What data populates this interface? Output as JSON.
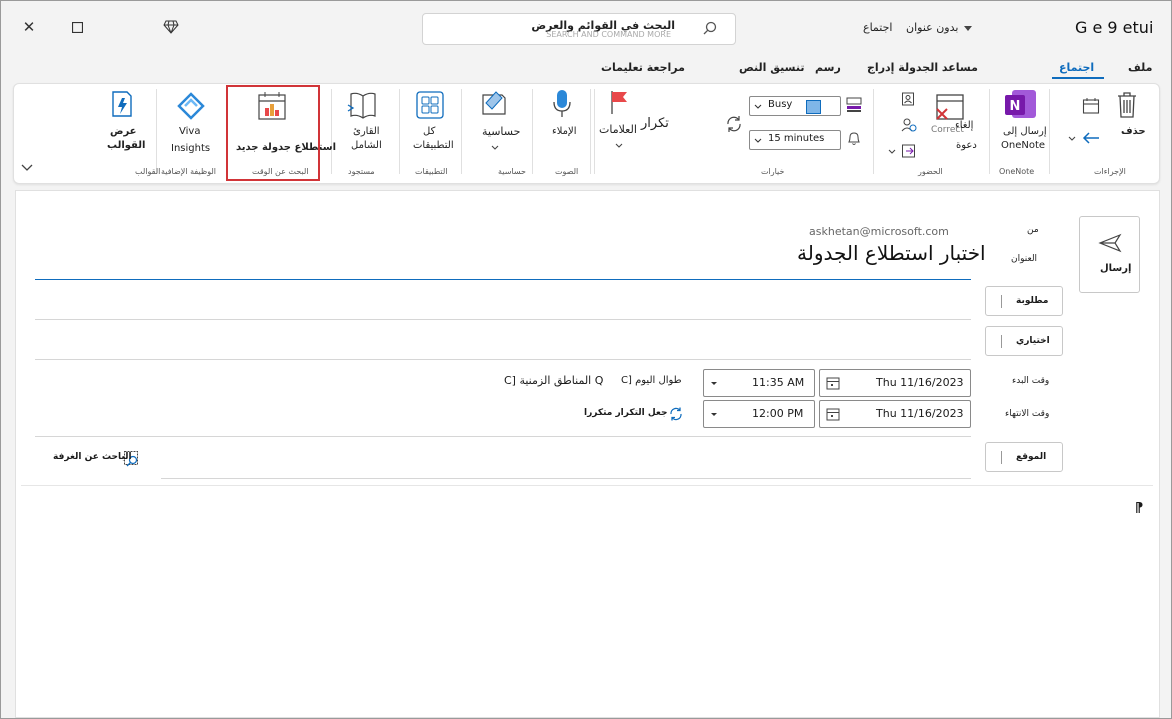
{
  "window": {
    "app_name": "G e 9 etui",
    "title_name": "بدون عنوان",
    "title_type": "اجتماع",
    "search_text": "البحث في القوائم والعرض",
    "search_placeholder": "SEARCH AND COMMAND MORE"
  },
  "tabs": [
    {
      "label": "ملف"
    },
    {
      "label": "اجتماع"
    },
    {
      "label": "مساعد الجدولة إدراج"
    },
    {
      "label": "رسم"
    },
    {
      "label": "تنسيق النص"
    },
    {
      "label": "مراجعة تعليمات"
    }
  ],
  "ribbon": {
    "delete_label": "حذف",
    "onenote_label1": "إرسال إلى",
    "onenote_label2": "OneNote",
    "cancel_label1": "إلغاء",
    "cancel_label2": "دعوة",
    "cancel_overlay": "Correct",
    "busy_value": "Busy",
    "reminder_value": "15 minutes",
    "tags_label": "العلامات",
    "recurrence_label": "تكرار",
    "dictate_label": "الإملاء",
    "sensitivity_label": "حساسية",
    "all_apps_label1": "كل",
    "all_apps_label2": "التطبيقات",
    "immersive_label1": "القارئ",
    "immersive_label2": "الشامل",
    "new_poll_label": "استطلاع جدولة جديد",
    "viva_label1": "Viva",
    "viva_label2": "Insights",
    "templates_label1": "عرض",
    "templates_label2": "القوالب",
    "groups": {
      "actions": "الإجراءات",
      "onenote": "OneNote",
      "attendees": "الحضور",
      "options": "خيارات",
      "tags": "",
      "voice": "الصوت",
      "sensitivity": "حساسية",
      "apps": "التطبيقات",
      "immersive": "مستجود",
      "find_time": "البحث عن الوقت",
      "addin": "الوظيفة الإضافية",
      "templates": "القوالب"
    }
  },
  "compose": {
    "send_label": "إرسال",
    "from_label": "من",
    "from_value": "askhetan@microsoft.com",
    "subject_label": "العنوان",
    "subject_value": "اختبار استطلاع الجدولة",
    "required_label": "مطلوبة",
    "optional_label": "اختياري",
    "start_label": "وقت البدء",
    "end_label": "وقت الانتهاء",
    "start_date": "Thu 11/16/2023",
    "start_time": "11:35 AM",
    "end_date": "Thu 11/16/2023",
    "end_time": "12:00 PM",
    "all_day_label": "C] طوال اليوم",
    "time_zones_label": "C] المناطق الزمنية Q",
    "recurring_label": "جعل التكرار متكررا",
    "location_label": "الموقع",
    "room_finder_label": "الباحث عن الغرفة",
    "body_mark": "⁋"
  },
  "colors": {
    "accent": "#0f6cbd",
    "highlight": "#d13438",
    "onenote": "#7719aa"
  }
}
